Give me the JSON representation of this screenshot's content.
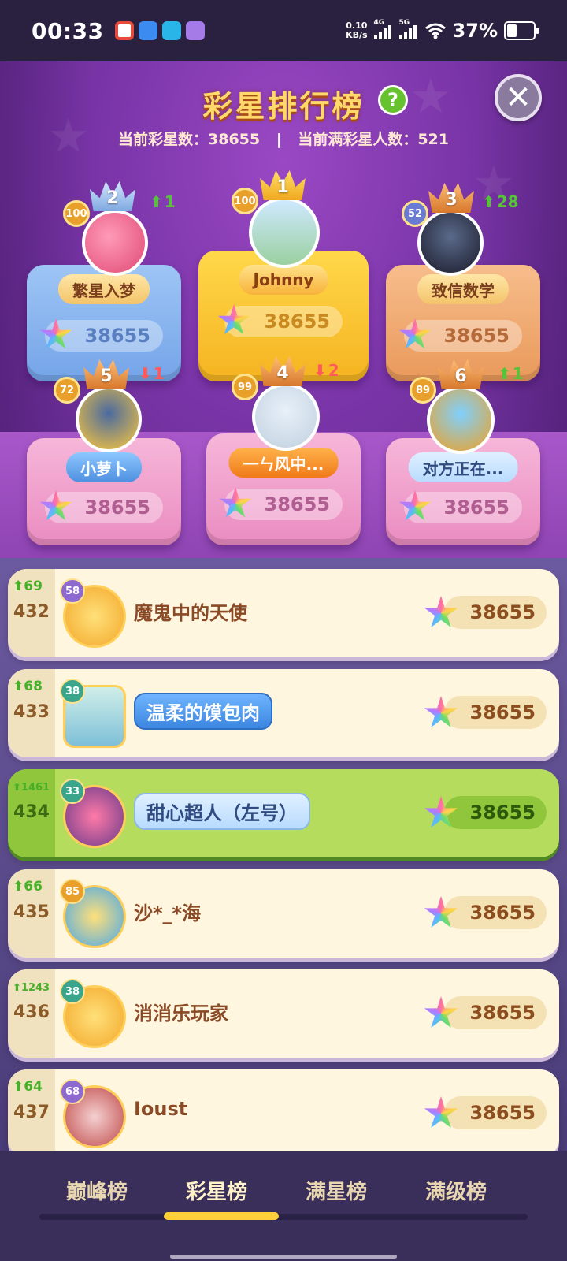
{
  "status_bar": {
    "time": "00:33",
    "net_speed_top": "0.10",
    "net_speed_bottom": "KB/s",
    "sig1": "4G",
    "sig2": "5G",
    "battery": "37%"
  },
  "header": {
    "title": "彩星排行榜",
    "help_icon": "?",
    "close_icon": "✕",
    "stat1": "当前彩星数：38655",
    "separator": "|",
    "stat2": "当前满彩星人数：521"
  },
  "podium": [
    {
      "rank": "1",
      "name": "Johnny",
      "level": "100",
      "score": "38655",
      "change": ""
    },
    {
      "rank": "2",
      "name": "繁星入梦",
      "level": "100",
      "score": "38655",
      "change": "1",
      "dir": "up"
    },
    {
      "rank": "3",
      "name": "致信数学",
      "level": "52",
      "score": "38655",
      "change": "28",
      "dir": "up"
    },
    {
      "rank": "4",
      "name": "一ㄣ风中...",
      "level": "99",
      "score": "38655",
      "change": "2",
      "dir": "down"
    },
    {
      "rank": "5",
      "name": "小萝卜",
      "level": "72",
      "score": "38655",
      "change": "1",
      "dir": "down"
    },
    {
      "rank": "6",
      "name": "对方正在...",
      "level": "89",
      "score": "38655",
      "change": "1",
      "dir": "up"
    }
  ],
  "list": [
    {
      "change": "69",
      "rank": "432",
      "level": "58",
      "name": "魔鬼中的天使",
      "score": "38655"
    },
    {
      "change": "68",
      "rank": "433",
      "level": "38",
      "name": "温柔的馍包肉",
      "score": "38655"
    },
    {
      "change": "1461",
      "rank": "434",
      "level": "33",
      "name": "甜心超人（左号）",
      "score": "38655"
    },
    {
      "change": "66",
      "rank": "435",
      "level": "85",
      "name": "沙*_*海",
      "score": "38655"
    },
    {
      "change": "1243",
      "rank": "436",
      "level": "38",
      "name": "消消乐玩家",
      "score": "38655"
    },
    {
      "change": "64",
      "rank": "437",
      "level": "68",
      "name": "Ioust",
      "score": "38655"
    }
  ],
  "tabs": [
    "巅峰榜",
    "彩星榜",
    "满星榜",
    "满级榜"
  ],
  "active_tab": "彩星榜",
  "colors": {
    "accent": "#ffcf3a",
    "up": "#56c43a",
    "down": "#ff5a5a"
  }
}
